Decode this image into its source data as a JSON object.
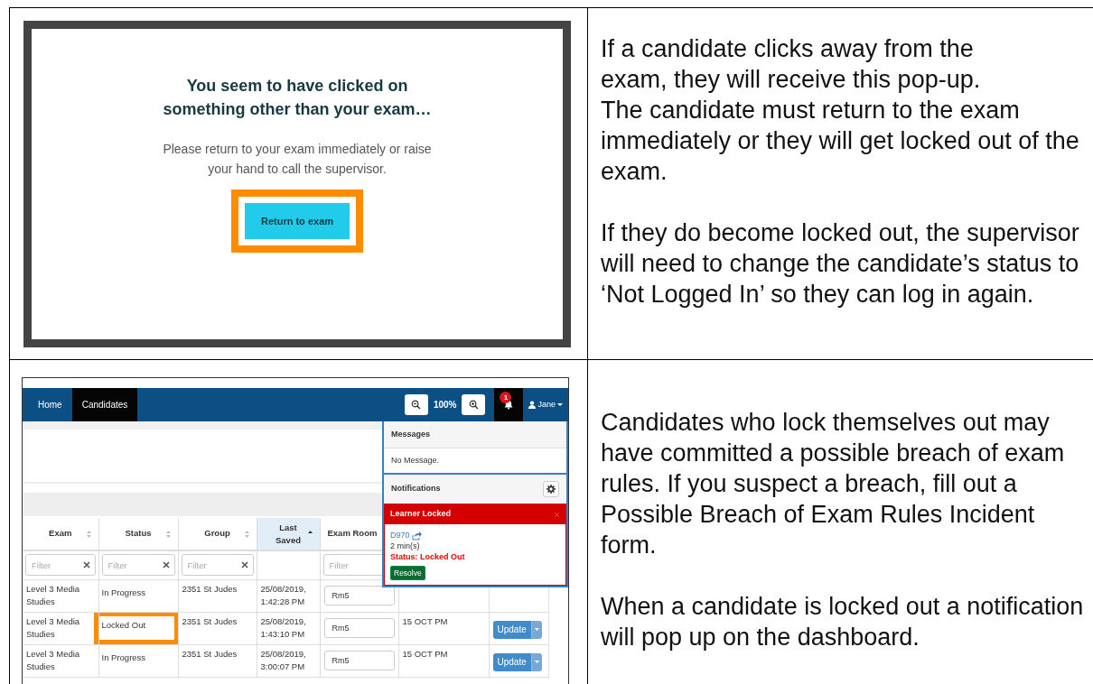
{
  "popup_example": {
    "heading": "You seem to have clicked on something other than your exam…",
    "message": "Please return to your exam immediately or raise your hand to call the supervisor.",
    "button": {
      "label": "Return to exam",
      "highlighted": true
    }
  },
  "popup_explanation": [
    [
      "If a candidate clicks away from the\nexam, they will receive this pop-up.",
      "The candidate must return to the exam immediately or they will get locked out of the exam."
    ],
    [
      "If they do become locked out, the supervisor will need to change the candidate’s status to ‘Not Logged In’ so they can log in again."
    ]
  ],
  "dashboard_example": {
    "nav": [
      {
        "label": "Home",
        "selected": false
      },
      {
        "label": "Candidates",
        "selected": true
      }
    ],
    "zoom": "100%",
    "notification_count": "1",
    "user": "Jane",
    "dropdown": {
      "messages_title": "Messages",
      "messages_text": "No Message.",
      "notifications_title": "Notifications",
      "notification": {
        "title": "Learner Locked",
        "link": "D970",
        "age": "2 min(s)",
        "status": "Status: Locked Out",
        "action": "Resolve"
      }
    },
    "columns": [
      {
        "label": "Exam",
        "kind": "sortable",
        "placeholder": "Filter",
        "clearable": true
      },
      {
        "label": "Status",
        "kind": "sortable",
        "placeholder": "Filter",
        "clearable": true
      },
      {
        "label": "Group",
        "kind": "sortable",
        "placeholder": "Filter",
        "clearable": true
      },
      {
        "label": "Last Saved",
        "kind": "ascending"
      },
      {
        "label": "Exam Room",
        "kind": "plain",
        "placeholder": "Filter",
        "clearable": false
      }
    ],
    "rows": [
      {
        "exam": "Level 3 Media Studies",
        "status": "In Progress",
        "highlighted": false,
        "group": "2351 St Judes",
        "last_saved": "25/08/2019, 1:42:28 PM",
        "room": "Rm5"
      },
      {
        "exam": "Level 3 Media Studies",
        "status": "Locked Out",
        "highlighted": true,
        "group": "2351 St Judes",
        "last_saved": "25/08/2019, 1:43:10 PM",
        "room": "Rm5",
        "column_6": "15 OCT PM",
        "action": "Update"
      },
      {
        "exam": "Level 3 Media Studies",
        "status": "In Progress",
        "highlighted": false,
        "group": "2351 St Judes",
        "last_saved": "25/08/2019, 3:00:07 PM",
        "room": "Rm5",
        "column_6": "15 OCT PM",
        "action": "Update"
      }
    ]
  },
  "dashboard_explanation": [
    [
      "Candidates who lock themselves out may have committed a possible breach of exam rules. If you suspect a breach, fill out a Possible Breach of Exam Rules Incident form."
    ],
    [
      "When a candidate is locked out a notification will pop up on the dashboard."
    ]
  ]
}
